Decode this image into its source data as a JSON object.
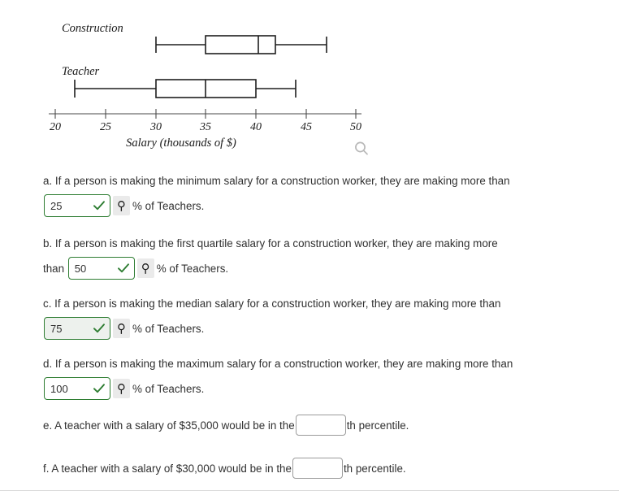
{
  "chart_data": {
    "type": "boxplot",
    "title": "",
    "xlabel": "Salary (thousands of $)",
    "ylabel": "",
    "xlim": [
      20,
      50
    ],
    "xticks": [
      20,
      25,
      30,
      35,
      40,
      45,
      50
    ],
    "xticklabels": [
      "20",
      "25",
      "30",
      "35",
      "40",
      "45",
      "50"
    ],
    "grid": false,
    "legend": "none",
    "orientation": "horizontal",
    "series": [
      {
        "name": "Construction",
        "min": 30,
        "q1": 35,
        "median": 40,
        "q3": 42,
        "max": 47
      },
      {
        "name": "Teacher",
        "min": 22,
        "q1": 30,
        "median": 35,
        "q3": 40,
        "max": 44
      }
    ]
  },
  "figure": {
    "labels": {
      "construction": "Construction",
      "teacher": "Teacher"
    },
    "axis_title": "Salary (thousands of $)",
    "zoom_icon": "search-icon"
  },
  "questions": [
    {
      "id": "a",
      "text_before": "a. If a person is making the minimum salary for a construction worker, they are making more than",
      "text_between": "",
      "value": "25",
      "placeholder": "",
      "status": "correct",
      "status_glyph": "✓",
      "tool_glyph": "⚲",
      "tool_name": "key-icon",
      "text_after": "% of Teachers.",
      "tinted": false
    },
    {
      "id": "b",
      "text_before": "b. If a person is making the first quartile salary for a construction worker, they are making more",
      "text_between": "than ",
      "value": "50",
      "placeholder": "",
      "status": "correct",
      "status_glyph": "✓",
      "tool_glyph": "⚲",
      "tool_name": "key-icon",
      "text_after": "% of Teachers.",
      "tinted": false
    },
    {
      "id": "c",
      "text_before": "c. If a person is making the median salary for a construction worker, they are making more than",
      "text_between": "",
      "value": "75",
      "placeholder": "",
      "status": "correct",
      "status_glyph": "✓",
      "tool_glyph": "⚲",
      "tool_name": "key-icon",
      "text_after": "% of Teachers.",
      "tinted": true
    },
    {
      "id": "d",
      "text_before": "d. If a person is making the maximum salary for a construction worker, they are making more than",
      "text_between": "",
      "value": "100",
      "placeholder": "",
      "status": "correct",
      "status_glyph": "✓",
      "tool_glyph": "⚲",
      "tool_name": "key-icon",
      "text_after": "% of Teachers.",
      "tinted": false
    },
    {
      "id": "e",
      "text_before": "e. A teacher with a salary of $35,000 would be in the",
      "value": "",
      "placeholder": "",
      "text_after": "th percentile."
    },
    {
      "id": "f",
      "text_before": "f. A teacher with a salary of $30,000 would be in the",
      "value": "",
      "placeholder": "",
      "text_after": "th percentile."
    }
  ],
  "colors": {
    "correct_border": "#2e7d32",
    "check": "#2e7d32",
    "blank_border": "#9b9b9b",
    "text": "#303030",
    "plot_stroke": "#1e1e1e",
    "axis": "#4a4a4a"
  }
}
